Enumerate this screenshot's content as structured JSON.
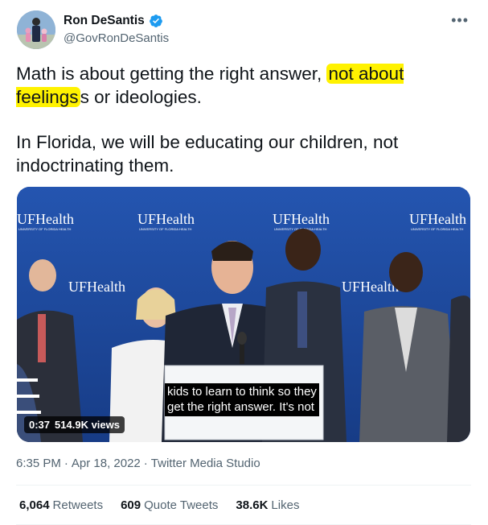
{
  "author": {
    "name": "Ron DeSantis",
    "handle": "@GovRonDeSantis",
    "verified": true
  },
  "more_label": "•••",
  "tweet": {
    "line1_part1": "Math is about getting the right answer, ",
    "line1_highlight": "not about feelings",
    "line1_part2": "s or ideologies.",
    "paragraph2": "In Florida, we will be educating our children, not indoctrinating them."
  },
  "media": {
    "caption_line1": "kids to learn to think so they",
    "caption_line2": "get the right answer. It's not",
    "duration": "0:37",
    "views": "514.9K views",
    "banner_logo": "UFHealth",
    "banner_subtitle": "UNIVERSITY OF FLORIDA HEALTH"
  },
  "meta": {
    "time": "6:35 PM",
    "separator1": "·",
    "date": "Apr 18, 2022",
    "separator2": "·",
    "source": "Twitter Media Studio"
  },
  "stats": {
    "retweets_count": "6,064",
    "retweets_label": "Retweets",
    "quote_count": "609",
    "quote_label": "Quote Tweets",
    "likes_count": "38.6K",
    "likes_label": "Likes"
  },
  "colors": {
    "verified_blue": "#1d9bf0",
    "highlight_yellow": "#fff200",
    "banner_blue": "#234a9c",
    "secondary_text": "#536471"
  }
}
